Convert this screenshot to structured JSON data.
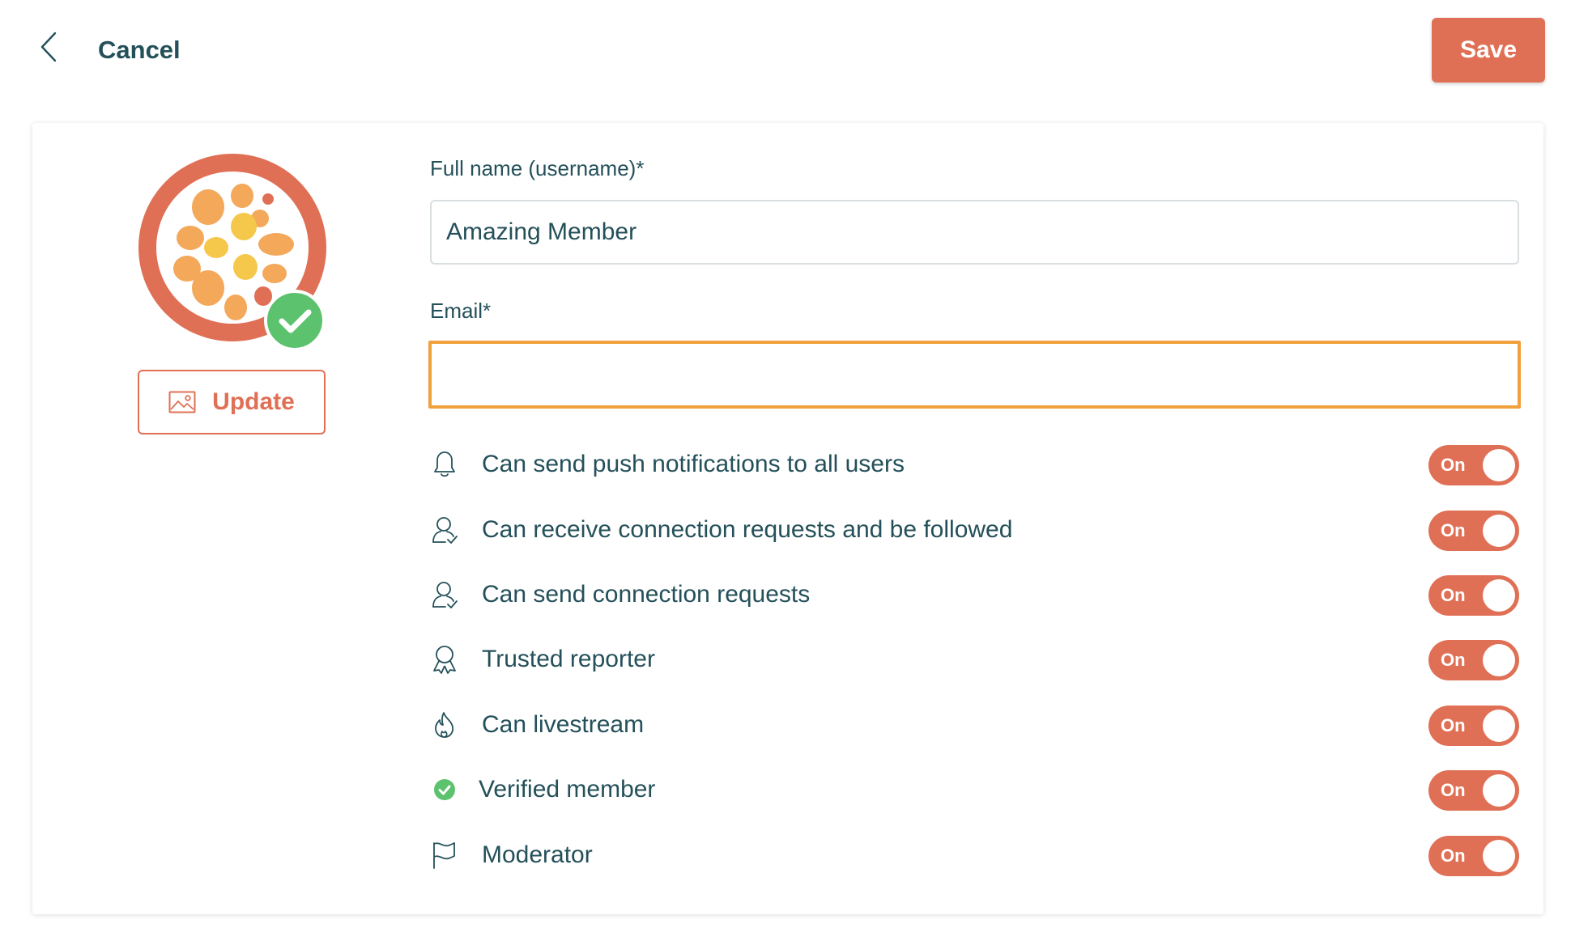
{
  "header": {
    "back_icon": "chevron-left-icon",
    "cancel_label": "Cancel",
    "save_label": "Save"
  },
  "profile": {
    "avatar_icon": "passion-fruit-avatar",
    "verified_icon": "check-circle-icon",
    "update_label": "Update",
    "update_icon": "image-icon"
  },
  "form": {
    "full_name": {
      "label": "Full name (username)*",
      "value": "Amazing Member"
    },
    "email": {
      "label": "Email*",
      "value": ""
    }
  },
  "permissions": [
    {
      "label": "Can send push notifications to all users",
      "icon": "bell-icon",
      "toggle": "On"
    },
    {
      "label": "Can receive connection requests and be followed",
      "icon": "user-check-icon",
      "toggle": "On"
    },
    {
      "label": "Can send connection requests",
      "icon": "user-check-icon",
      "toggle": "On"
    },
    {
      "label": "Trusted reporter",
      "icon": "award-ribbon-icon",
      "toggle": "On"
    },
    {
      "label": "Can livestream",
      "icon": "flame-icon",
      "toggle": "On"
    },
    {
      "label": "Verified member",
      "icon": "check-circle-icon",
      "toggle": "On"
    },
    {
      "label": "Moderator",
      "icon": "flag-icon",
      "toggle": "On"
    }
  ],
  "colors": {
    "accent": "#e07055",
    "text": "#24505a",
    "focus_border": "#f0a03c",
    "verified_green": "#5cc26e",
    "input_border": "#d9dfe1"
  }
}
